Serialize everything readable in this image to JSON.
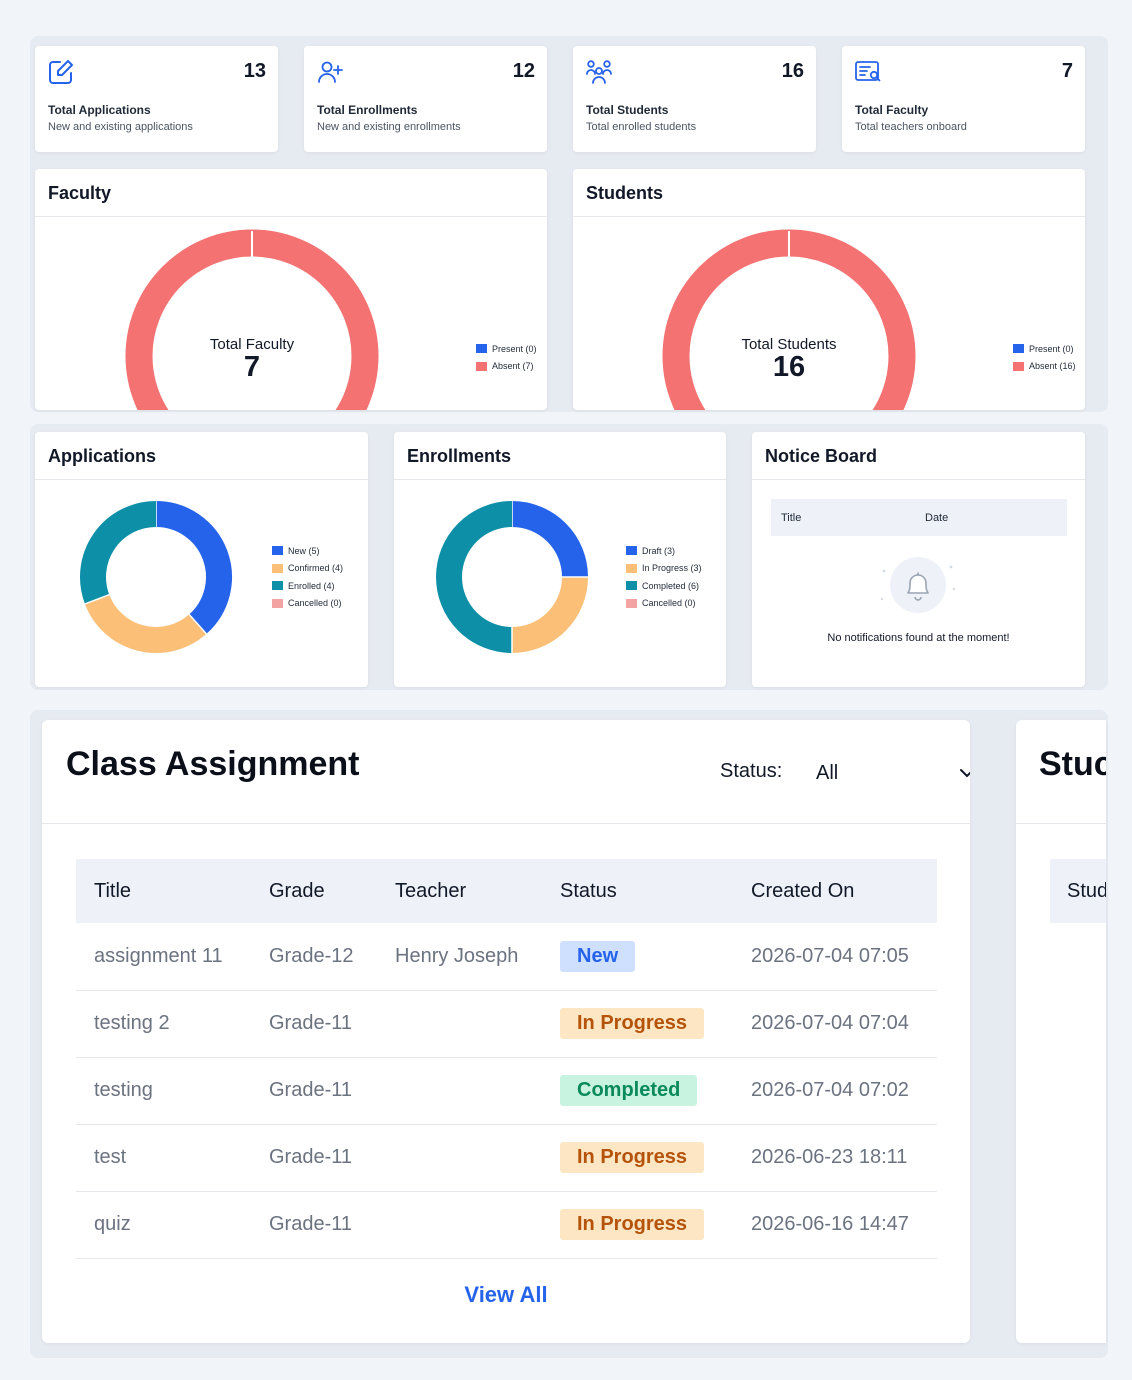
{
  "stats": [
    {
      "value": "13",
      "label": "Total Applications",
      "sub": "New and existing applications",
      "icon": "edit-icon"
    },
    {
      "value": "12",
      "label": "Total Enrollments",
      "sub": "New and existing enrollments",
      "icon": "user-plus-icon"
    },
    {
      "value": "16",
      "label": "Total Students",
      "sub": "Total enrolled students",
      "icon": "users-icon"
    },
    {
      "value": "7",
      "label": "Total Faculty",
      "sub": "Total teachers onboard",
      "icon": "id-card-icon"
    }
  ],
  "faculty": {
    "title": "Faculty",
    "center_label": "Total Faculty",
    "center_value": "7",
    "legend": [
      "Present (0)",
      "Absent (7)"
    ]
  },
  "students": {
    "title": "Students",
    "center_label": "Total Students",
    "center_value": "16",
    "legend": [
      "Present (0)",
      "Absent (16)"
    ]
  },
  "applications": {
    "title": "Applications",
    "legend": [
      "New (5)",
      "Confirmed (4)",
      "Enrolled (4)",
      "Cancelled (0)"
    ]
  },
  "enrollments": {
    "title": "Enrollments",
    "legend": [
      "Draft (3)",
      "In Progress (3)",
      "Completed (6)",
      "Cancelled (0)"
    ]
  },
  "notice_board": {
    "title": "Notice Board",
    "col_title": "Title",
    "col_date": "Date",
    "empty_message": "No notifications found at the moment!",
    "icon": "bell-icon"
  },
  "class_assignment": {
    "title": "Class Assignment",
    "status_label": "Status:",
    "status_value": "All",
    "columns": [
      "Title",
      "Grade",
      "Teacher",
      "Status",
      "Created On"
    ],
    "rows": [
      {
        "title": "assignment 11",
        "grade": "Grade-12",
        "teacher": "Henry Joseph",
        "status": "New",
        "created": "2026-07-04 07:05"
      },
      {
        "title": "testing 2",
        "grade": "Grade-11",
        "teacher": "",
        "status": "In Progress",
        "created": "2026-07-04 07:04"
      },
      {
        "title": "testing",
        "grade": "Grade-11",
        "teacher": "",
        "status": "Completed",
        "created": "2026-07-04 07:02"
      },
      {
        "title": "test",
        "grade": "Grade-11",
        "teacher": "",
        "status": "In Progress",
        "created": "2026-06-23 18:11"
      },
      {
        "title": "quiz",
        "grade": "Grade-11",
        "teacher": "",
        "status": "In Progress",
        "created": "2026-06-16 14:47"
      }
    ],
    "view_all": "View All"
  },
  "student_panel": {
    "title": "Stuc",
    "col": "Stud"
  },
  "colors": {
    "blue": "#2563eb",
    "orange": "#fbbf77",
    "teal": "#0e8fa8",
    "pink": "#f4a3a3",
    "red": "#f47272"
  },
  "chart_data": [
    {
      "type": "pie",
      "title": "Faculty",
      "categories": [
        "Present",
        "Absent"
      ],
      "values": [
        0,
        7
      ]
    },
    {
      "type": "pie",
      "title": "Students",
      "categories": [
        "Present",
        "Absent"
      ],
      "values": [
        0,
        16
      ]
    },
    {
      "type": "pie",
      "title": "Applications",
      "categories": [
        "New",
        "Confirmed",
        "Enrolled",
        "Cancelled"
      ],
      "values": [
        5,
        4,
        4,
        0
      ]
    },
    {
      "type": "pie",
      "title": "Enrollments",
      "categories": [
        "Draft",
        "In Progress",
        "Completed",
        "Cancelled"
      ],
      "values": [
        3,
        3,
        6,
        0
      ]
    }
  ]
}
